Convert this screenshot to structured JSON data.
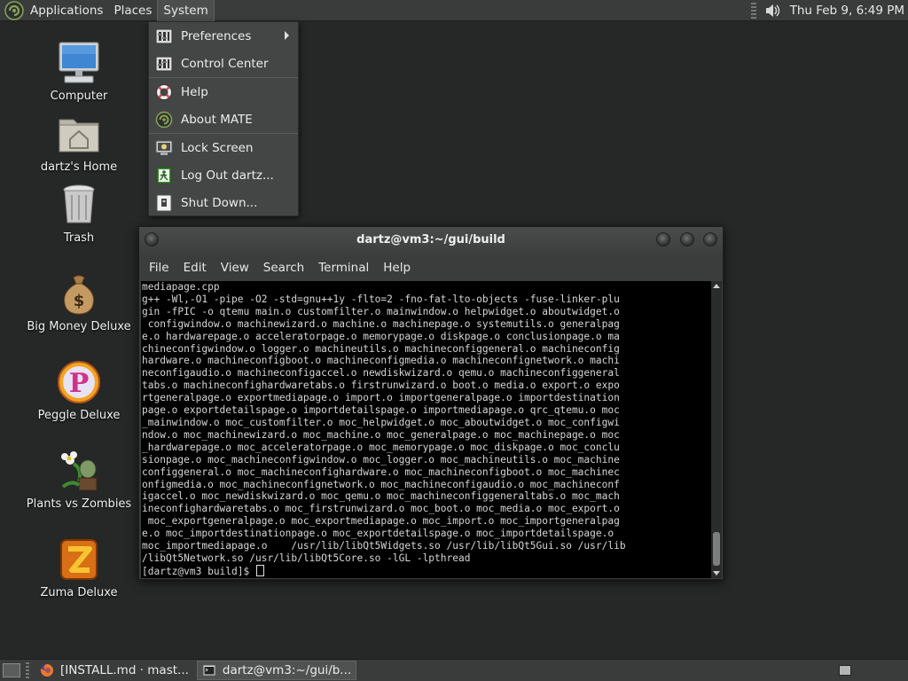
{
  "top_panel": {
    "menus": [
      {
        "label": "Applications"
      },
      {
        "label": "Places"
      },
      {
        "label": "System"
      }
    ],
    "clock": "Thu Feb  9,  6:49 PM"
  },
  "desktop_icons": [
    {
      "label": "Computer",
      "icon": "computer-icon"
    },
    {
      "label": "dartz's Home",
      "icon": "home-folder-icon"
    },
    {
      "label": "Trash",
      "icon": "trash-icon"
    },
    {
      "label": "Big Money Deluxe",
      "icon": "money-bag-icon"
    },
    {
      "label": "Peggle Deluxe",
      "icon": "peggle-icon"
    },
    {
      "label": "Plants vs Zombies",
      "icon": "plants-vs-zombies-icon"
    },
    {
      "label": "Zuma Deluxe",
      "icon": "zuma-icon"
    }
  ],
  "system_menu": {
    "items": [
      {
        "label": "Preferences",
        "icon": "preferences-icon",
        "has_submenu": true
      },
      {
        "label": "Control Center",
        "icon": "control-center-icon"
      },
      {
        "label": "Help",
        "icon": "help-icon"
      },
      {
        "label": "About MATE",
        "icon": "mate-logo-icon"
      },
      {
        "label": "Lock Screen",
        "icon": "lock-screen-icon"
      },
      {
        "label": "Log Out dartz...",
        "icon": "log-out-icon"
      },
      {
        "label": "Shut Down...",
        "icon": "shut-down-icon"
      }
    ]
  },
  "terminal": {
    "title": "dartz@vm3:~/gui/build",
    "menu": [
      "File",
      "Edit",
      "View",
      "Search",
      "Terminal",
      "Help"
    ],
    "lines": [
      "mediapage.cpp",
      "g++ -Wl,-O1 -pipe -O2 -std=gnu++1y -flto=2 -fno-fat-lto-objects -fuse-linker-plu",
      "gin -fPIC -o qtemu main.o customfilter.o mainwindow.o helpwidget.o aboutwidget.o",
      " configwindow.o machinewizard.o machine.o machinepage.o systemutils.o generalpag",
      "e.o hardwarepage.o acceleratorpage.o memorypage.o diskpage.o conclusionpage.o ma",
      "chineconfigwindow.o logger.o machineutils.o machineconfiggeneral.o machineconfig",
      "hardware.o machineconfigboot.o machineconfigmedia.o machineconfignetwork.o machi",
      "neconfigaudio.o machineconfigaccel.o newdiskwizard.o qemu.o machineconfiggeneral",
      "tabs.o machineconfighardwaretabs.o firstrunwizard.o boot.o media.o export.o expo",
      "rtgeneralpage.o exportmediapage.o import.o importgeneralpage.o importdestination",
      "page.o exportdetailspage.o importdetailspage.o importmediapage.o qrc_qtemu.o moc",
      "_mainwindow.o moc_customfilter.o moc_helpwidget.o moc_aboutwidget.o moc_configwi",
      "ndow.o moc_machinewizard.o moc_machine.o moc_generalpage.o moc_machinepage.o moc",
      "_hardwarepage.o moc_acceleratorpage.o moc_memorypage.o moc_diskpage.o moc_conclu",
      "sionpage.o moc_machineconfigwindow.o moc_logger.o moc_machineutils.o moc_machine",
      "configgeneral.o moc_machineconfighardware.o moc_machineconfigboot.o moc_machinec",
      "onfigmedia.o moc_machineconfignetwork.o moc_machineconfigaudio.o moc_machineconf",
      "igaccel.o moc_newdiskwizard.o moc_qemu.o moc_machineconfiggeneraltabs.o moc_mach",
      "ineconfighardwaretabs.o moc_firstrunwizard.o moc_boot.o moc_media.o moc_export.o",
      " moc_exportgeneralpage.o moc_exportmediapage.o moc_import.o moc_importgeneralpag",
      "e.o moc_importdestinationpage.o moc_exportdetailspage.o moc_importdetailspage.o ",
      "moc_importmediapage.o    /usr/lib/libQt5Widgets.so /usr/lib/libQt5Gui.so /usr/lib",
      "/libQt5Network.so /usr/lib/libQt5Core.so -lGL -lpthread"
    ],
    "prompt": "[dartz@vm3 build]$ "
  },
  "bottom_panel": {
    "tasks": [
      {
        "label": "[INSTALL.md · mast...",
        "icon": "firefox-icon"
      },
      {
        "label": "dartz@vm3:~/gui/b...",
        "icon": "terminal-icon"
      }
    ]
  }
}
